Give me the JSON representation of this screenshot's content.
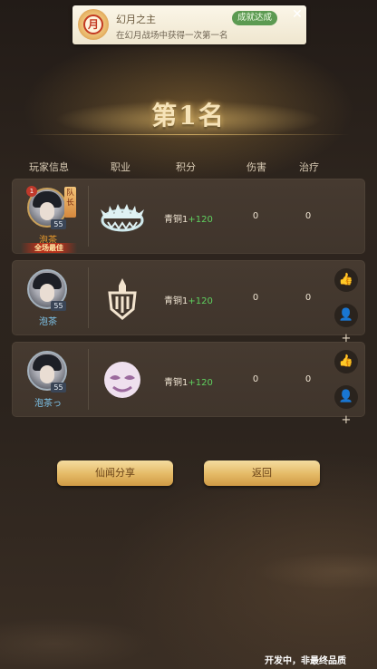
{
  "toast": {
    "title": "幻月之主",
    "description": "在幻月战场中获得一次第一名",
    "tag": "成就达成",
    "badge_char": "月",
    "close_icon": "close-icon"
  },
  "result": {
    "rank_title": "第1名"
  },
  "headers": {
    "player_info": "玩家信息",
    "profession": "职业",
    "score": "积分",
    "damage": "伤害",
    "healing": "治疗"
  },
  "players": [
    {
      "name": "泡茶",
      "level": "55",
      "leader_tag": "队长",
      "rank_badge": "1",
      "mvp": "全场最佳",
      "class_icon": "crown-spikes-icon",
      "score_base": "青铜1",
      "score_delta": "+120",
      "damage": "0",
      "healing": "0",
      "name_color": "#e99a2c"
    },
    {
      "name": "泡茶",
      "level": "55",
      "class_icon": "sword-shield-icon",
      "score_base": "青铜1",
      "score_delta": "+120",
      "damage": "0",
      "healing": "0",
      "name_color": "#7fc6ec",
      "like_icon": "thumbs-up-icon",
      "add_friend_icon": "add-friend-icon"
    },
    {
      "name": "泡茶っ",
      "level": "55",
      "class_icon": "cloud-mask-icon",
      "score_base": "青铜1",
      "score_delta": "+120",
      "damage": "0",
      "healing": "0",
      "name_color": "#7fc6ec",
      "like_icon": "thumbs-up-icon",
      "add_friend_icon": "add-friend-icon"
    }
  ],
  "buttons": {
    "share": "仙闻分享",
    "back": "返回"
  },
  "footer": "开发中，非最终品质"
}
